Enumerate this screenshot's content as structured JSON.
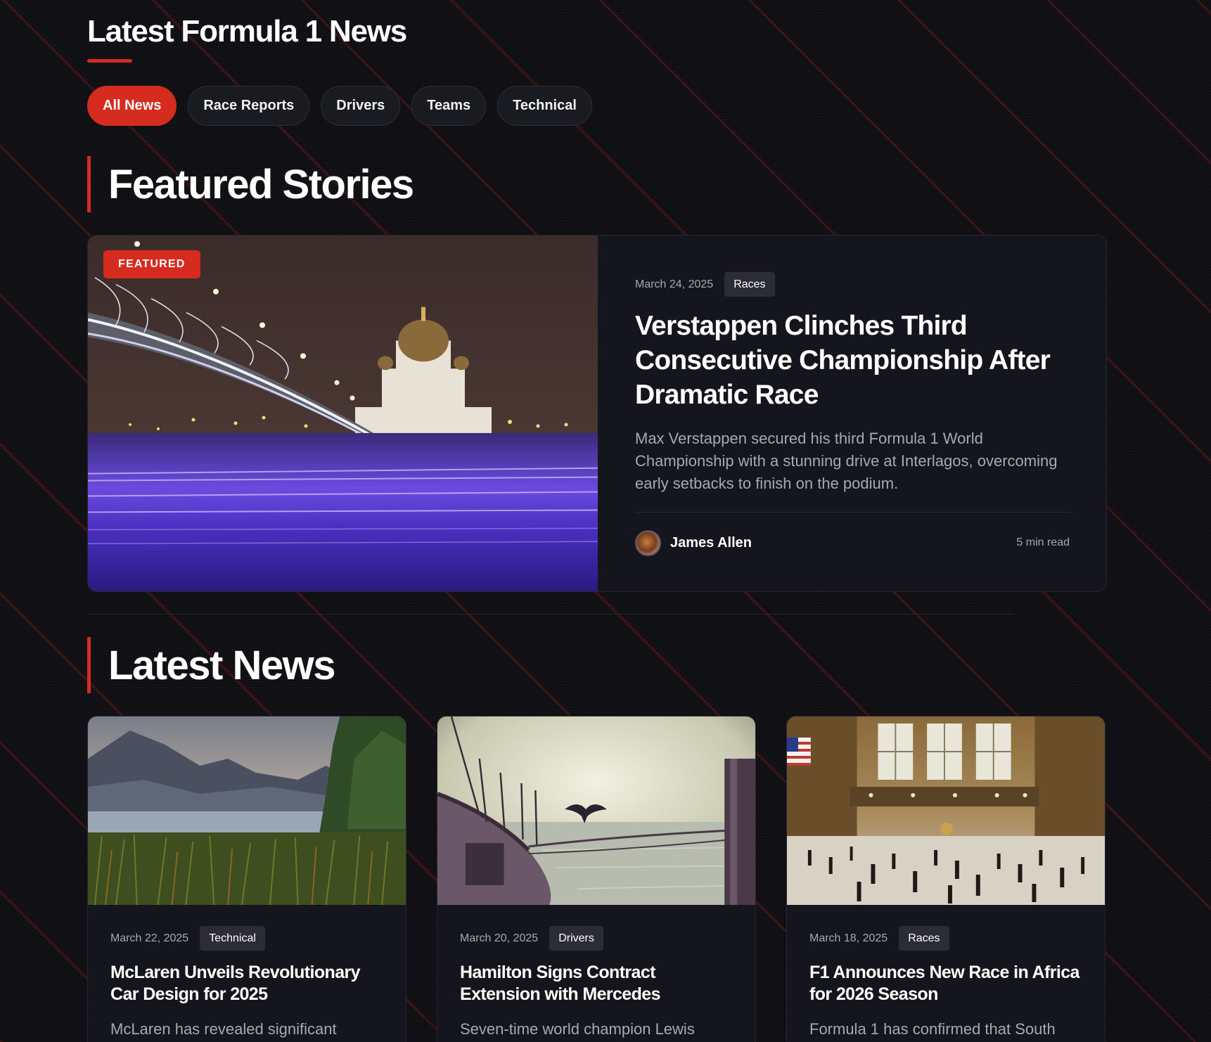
{
  "header": {
    "title": "Latest Formula 1 News"
  },
  "filters": [
    {
      "label": "All News",
      "active": true
    },
    {
      "label": "Race Reports",
      "active": false
    },
    {
      "label": "Drivers",
      "active": false
    },
    {
      "label": "Teams",
      "active": false
    },
    {
      "label": "Technical",
      "active": false
    }
  ],
  "featured_section": {
    "heading": "Featured Stories"
  },
  "featured": {
    "badge": "FEATURED",
    "date": "March 24, 2025",
    "tag": "Races",
    "title": "Verstappen Clinches Third Consecutive Championship After Dramatic Race",
    "excerpt": "Max Verstappen secured his third Formula 1 World Championship with a stunning drive at Interlagos, overcoming early setbacks to finish on the podium.",
    "author": "James Allen",
    "read_time": "5 min read"
  },
  "latest_section": {
    "heading": "Latest News"
  },
  "news": [
    {
      "date": "March 22, 2025",
      "tag": "Technical",
      "title": "McLaren Unveils Revolutionary Car Design for 2025",
      "excerpt": "McLaren has revealed significant"
    },
    {
      "date": "March 20, 2025",
      "tag": "Drivers",
      "title": "Hamilton Signs Contract Extension with Mercedes",
      "excerpt": "Seven-time world champion Lewis"
    },
    {
      "date": "March 18, 2025",
      "tag": "Races",
      "title": "F1 Announces New Race in Africa for 2026 Season",
      "excerpt": "Formula 1 has confirmed that South"
    }
  ],
  "colors": {
    "accent": "#d62b1f",
    "background": "#0f0f14",
    "card": "#15151d",
    "muted_text": "#a8a8b3"
  }
}
